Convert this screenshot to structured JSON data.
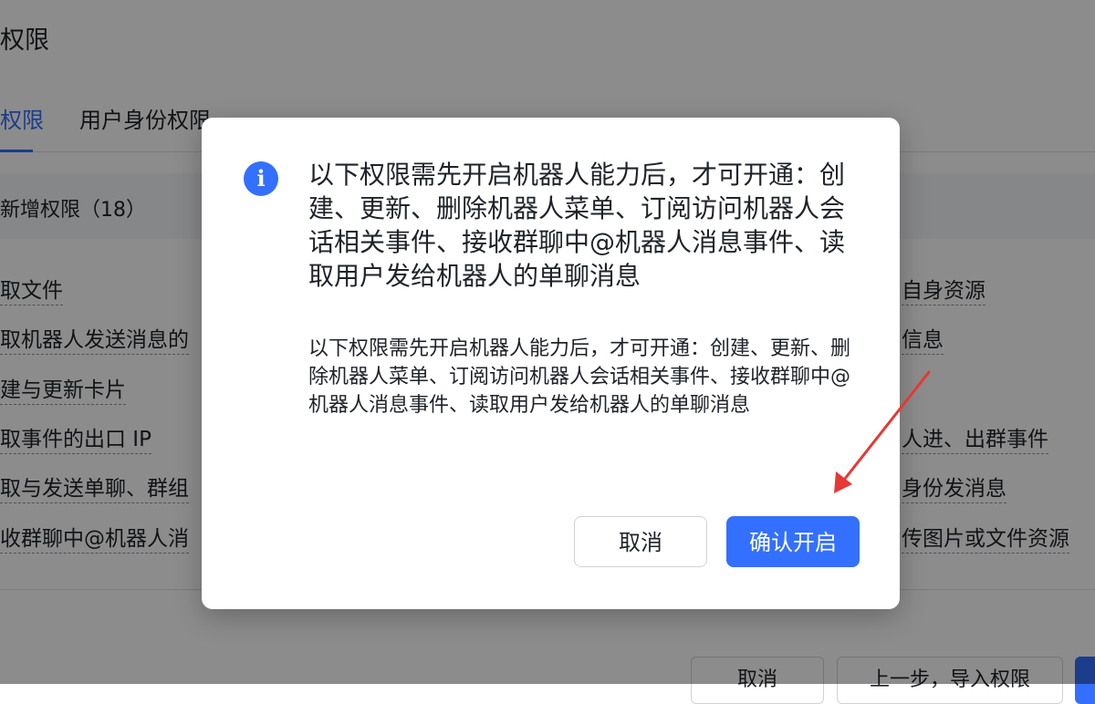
{
  "page": {
    "title": "权限",
    "tabs": [
      {
        "label": "权限",
        "active": true
      },
      {
        "label": "用户身份权限",
        "active": false
      }
    ],
    "section_title": "新增权限（18）",
    "permissions_left": [
      "取文件",
      "取机器人发送消息的",
      "建与更新卡片",
      "取事件的出口 IP",
      "取与发送单聊、群组",
      "收群聊中@机器人消"
    ],
    "permissions_right": [
      "自身资源",
      "信息",
      "人进、出群事件",
      "身份发消息",
      "传图片或文件资源"
    ],
    "bottom_buttons": {
      "cancel": "取消",
      "prev_import": "上一步，导入权限"
    }
  },
  "dialog": {
    "icon": "info-icon",
    "title": "以下权限需先开启机器人能力后，才可开通：创建、更新、删除机器人菜单、订阅访问机器人会话相关事件、接收群聊中@机器人消息事件、读取用户发给机器人的单聊消息",
    "body": "以下权限需先开启机器人能力后，才可开通：创建、更新、删除机器人菜单、订阅访问机器人会话相关事件、接收群聊中@机器人消息事件、读取用户发给机器人的单聊消息",
    "cancel_label": "取消",
    "confirm_label": "确认开启"
  },
  "colors": {
    "accent": "#3370ff",
    "overlay": "rgba(0,0,0,0.45)",
    "annotation_arrow": "#e53935"
  }
}
